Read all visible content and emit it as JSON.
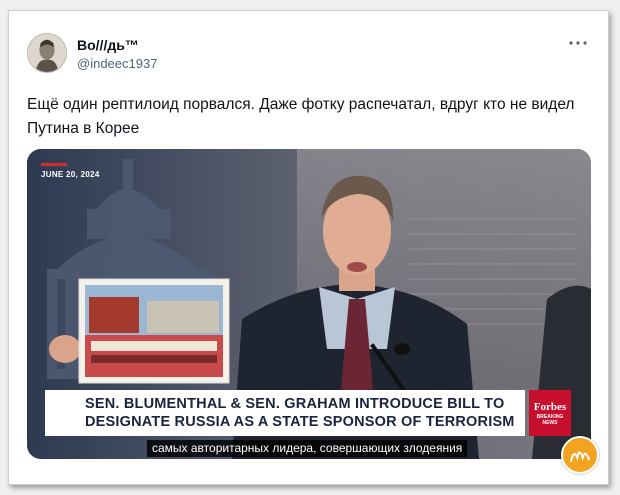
{
  "tweet": {
    "display_name": "Во///дь™",
    "handle": "@indeec1937",
    "text": "Ещё один рептилоид порвался. Даже фотку распечатал, вдруг кто не видел Путина в Корее",
    "more_icon": "more-horizontal-icon"
  },
  "media": {
    "date": "JUNE 20, 2024",
    "headline_line1": "SEN. BLUMENTHAL & SEN. GRAHAM INTRODUCE BILL TO",
    "headline_line2": "DESIGNATE RUSSIA AS A STATE SPONSOR OF TERRORISM",
    "brand": "Forbes",
    "brand_sub1": "BREAKING",
    "brand_sub2": "NEWS",
    "subtitle": "самых авторитарных лидера, совершающих злодеяния"
  },
  "colors": {
    "accent_red": "#c8102e",
    "headline_navy": "#1a2340",
    "watermark_orange": "#f2a31f"
  }
}
